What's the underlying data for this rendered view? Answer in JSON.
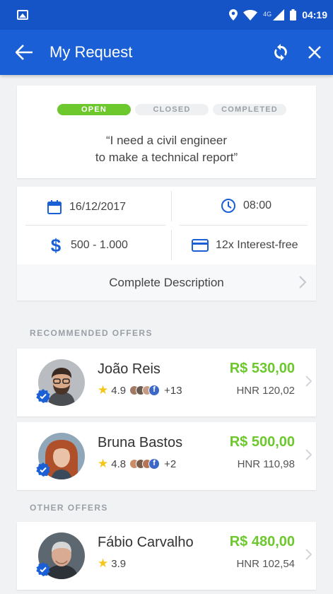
{
  "status_bar": {
    "network": "4G",
    "time": "04:19"
  },
  "app_bar": {
    "title": "My Request"
  },
  "request": {
    "tabs": [
      {
        "label": "OPEN",
        "active": true
      },
      {
        "label": "CLOSED",
        "active": false
      },
      {
        "label": "COMPLETED",
        "active": false
      }
    ],
    "quote_line1": "“I need a civil engineer",
    "quote_line2": "to make a technical report”"
  },
  "details": {
    "date": "16/12/2017",
    "time": "08:00",
    "price_range": "500 - 1.000",
    "payment": "12x Interest-free",
    "description_label": "Complete Description"
  },
  "sections": {
    "recommended": "RECOMMENDED OFFERS",
    "other": "OTHER OFFERS"
  },
  "offers": [
    {
      "name": "João Reis",
      "rating": "4.9",
      "friends": "+13",
      "price": "R$ 530,00",
      "hnr": "HNR 120,02"
    },
    {
      "name": "Bruna Bastos",
      "rating": "4.8",
      "friends": "+2",
      "price": "R$ 500,00",
      "hnr": "HNR 110,98"
    },
    {
      "name": "Fábio Carvalho",
      "rating": "3.9",
      "price": "R$ 480,00",
      "hnr": "HNR 102,54"
    }
  ],
  "colors": {
    "primary": "#1a5fd6",
    "status_bar": "#1454c7",
    "accent_green": "#6cc82c",
    "star": "#f5c518"
  }
}
